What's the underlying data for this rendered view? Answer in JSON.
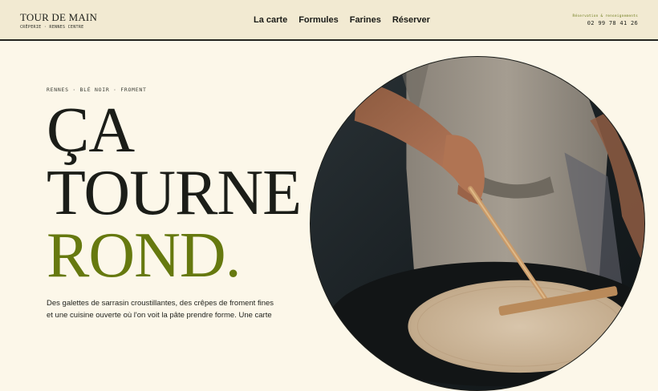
{
  "brand": {
    "name": "TOUR DE MAIN",
    "tagline": "CRÊPERIE · RENNES CENTRE"
  },
  "nav": {
    "items": [
      "La carte",
      "Formules",
      "Farines",
      "Réserver"
    ]
  },
  "contact": {
    "label": "Réservation & renseignements",
    "phone": "02 99 78 41 26"
  },
  "hero": {
    "eyebrow": "RENNES · BLÉ NOIR · FROMENT",
    "headline": [
      "ÇA",
      "TOURNE",
      "ROND."
    ],
    "intro": "Des galettes de sarrasin croustillantes, des crêpes de froment fines et une cuisine ouverte où l'on voit la pâte prendre forme. Une carte",
    "accent_color": "#66790f"
  }
}
